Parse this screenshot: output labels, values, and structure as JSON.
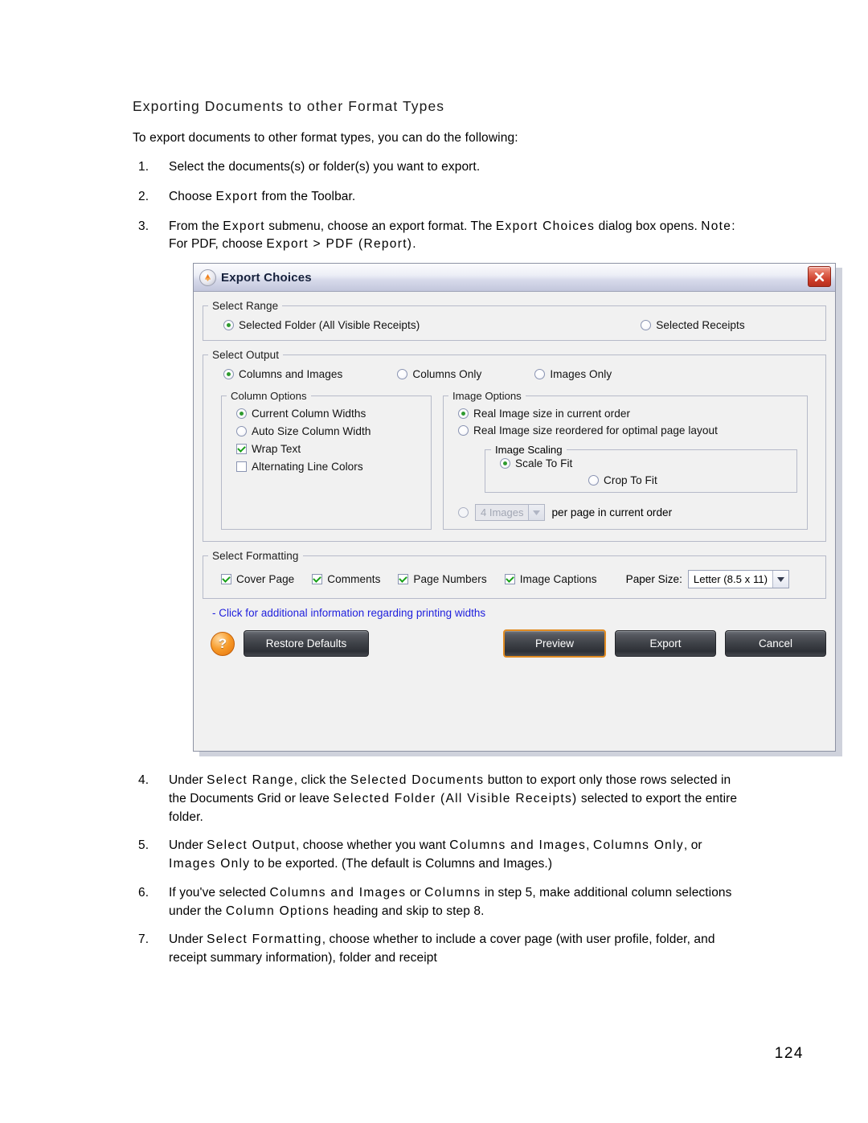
{
  "document": {
    "heading": "Exporting Documents to other Format Types",
    "intro": "To export documents to other format types, you can do the following:",
    "steps_before": [
      {
        "num": "1.",
        "parts": [
          {
            "t": "Select the documents(s) or folder(s) you want to export.",
            "e": false
          }
        ]
      },
      {
        "num": "2.",
        "parts": [
          {
            "t": "Choose ",
            "e": false
          },
          {
            "t": "Export",
            "e": true
          },
          {
            "t": " from the Toolbar.",
            "e": false
          }
        ]
      },
      {
        "num": "3.",
        "parts": [
          {
            "t": "From the ",
            "e": false
          },
          {
            "t": "Export",
            "e": true
          },
          {
            "t": " submenu, choose an export format. The ",
            "e": false
          },
          {
            "t": "Export Choices",
            "e": true
          },
          {
            "t": " dialog box opens. ",
            "e": false
          },
          {
            "t": "Note:",
            "e": true
          },
          {
            "t": " For PDF, choose ",
            "e": false
          },
          {
            "t": "Export > PDF (Report).",
            "e": true
          }
        ]
      }
    ],
    "steps_after": [
      {
        "num": "4.",
        "parts": [
          {
            "t": "Under ",
            "e": false
          },
          {
            "t": "Select Range",
            "e": true
          },
          {
            "t": ", click the ",
            "e": false
          },
          {
            "t": "Selected Documents",
            "e": true
          },
          {
            "t": " button to export only those rows selected in the Documents Grid or leave ",
            "e": false
          },
          {
            "t": "Selected Folder (All Visible Receipts)",
            "e": true
          },
          {
            "t": " selected to export the entire folder.",
            "e": false
          }
        ]
      },
      {
        "num": "5.",
        "parts": [
          {
            "t": "Under ",
            "e": false
          },
          {
            "t": "Select Output",
            "e": true
          },
          {
            "t": ", choose whether you want ",
            "e": false
          },
          {
            "t": "Columns and Images",
            "e": true
          },
          {
            "t": ", ",
            "e": false
          },
          {
            "t": "Columns Only",
            "e": true
          },
          {
            "t": ", or ",
            "e": false
          },
          {
            "t": "Images Only",
            "e": true
          },
          {
            "t": " to be exported. (The default is Columns and Images.)",
            "e": false
          }
        ]
      },
      {
        "num": "6.",
        "parts": [
          {
            "t": "If you've selected ",
            "e": false
          },
          {
            "t": "Columns and Images",
            "e": true
          },
          {
            "t": " or ",
            "e": false
          },
          {
            "t": "Columns",
            "e": true
          },
          {
            "t": " in step 5, make additional column selections under the ",
            "e": false
          },
          {
            "t": "Column Options",
            "e": true
          },
          {
            "t": " heading and skip to step 8.",
            "e": false
          }
        ]
      },
      {
        "num": "7.",
        "parts": [
          {
            "t": "Under ",
            "e": false
          },
          {
            "t": "Select Formatting",
            "e": true
          },
          {
            "t": ", choose whether to include a cover page (with user profile, folder, and receipt summary information), folder and receipt",
            "e": false
          }
        ]
      }
    ],
    "page_number": "124"
  },
  "dialog": {
    "title": "Export Choices",
    "app_icon": "export-app-icon",
    "close_icon": "close-icon",
    "select_range": {
      "legend": "Select Range",
      "options": [
        {
          "label": "Selected Folder (All Visible Receipts)",
          "selected": true
        },
        {
          "label": "Selected Receipts",
          "selected": false
        }
      ]
    },
    "select_output": {
      "legend": "Select Output",
      "options": [
        {
          "label": "Columns and Images",
          "selected": true
        },
        {
          "label": "Columns Only",
          "selected": false
        },
        {
          "label": "Images Only",
          "selected": false
        }
      ],
      "column_options": {
        "legend": "Column Options",
        "radios": [
          {
            "label": "Current Column Widths",
            "selected": true
          },
          {
            "label": "Auto Size Column Width",
            "selected": false
          }
        ],
        "checks": [
          {
            "label": "Wrap Text",
            "checked": true
          },
          {
            "label": "Alternating Line Colors",
            "checked": false
          }
        ]
      },
      "image_options": {
        "legend": "Image Options",
        "radios": [
          {
            "label": "Real Image size in current order",
            "selected": true
          },
          {
            "label": "Real Image size reordered for optimal page layout",
            "selected": false
          }
        ],
        "image_scaling": {
          "legend": "Image Scaling",
          "options": [
            {
              "label": "Scale To Fit",
              "selected": true
            },
            {
              "label": "Crop To Fit",
              "selected": false
            }
          ]
        },
        "per_page": {
          "selected": false,
          "disabled": true,
          "count_value": "4 Images",
          "suffix_label": "per page in current order"
        }
      }
    },
    "select_formatting": {
      "legend": "Select Formatting",
      "checks": [
        {
          "label": "Cover Page",
          "checked": true
        },
        {
          "label": "Comments",
          "checked": true
        },
        {
          "label": "Page Numbers",
          "checked": true
        },
        {
          "label": "Image Captions",
          "checked": true
        }
      ],
      "paper_size_label": "Paper Size:",
      "paper_size_value": "Letter (8.5 x 11)"
    },
    "info_link": "- Click for additional information regarding printing widths",
    "buttons": {
      "help_icon": "help-question-icon",
      "restore": "Restore Defaults",
      "preview": "Preview",
      "export": "Export",
      "cancel": "Cancel"
    },
    "colors": {
      "link": "#2020dd",
      "radio_dot": "#2f9b2f",
      "check_mark": "#18a018",
      "close_button": "#cc3b28",
      "default_button_outline": "#e08b22",
      "help_icon": "#f79b2a",
      "dialog_bg": "#f1f1f1"
    }
  }
}
